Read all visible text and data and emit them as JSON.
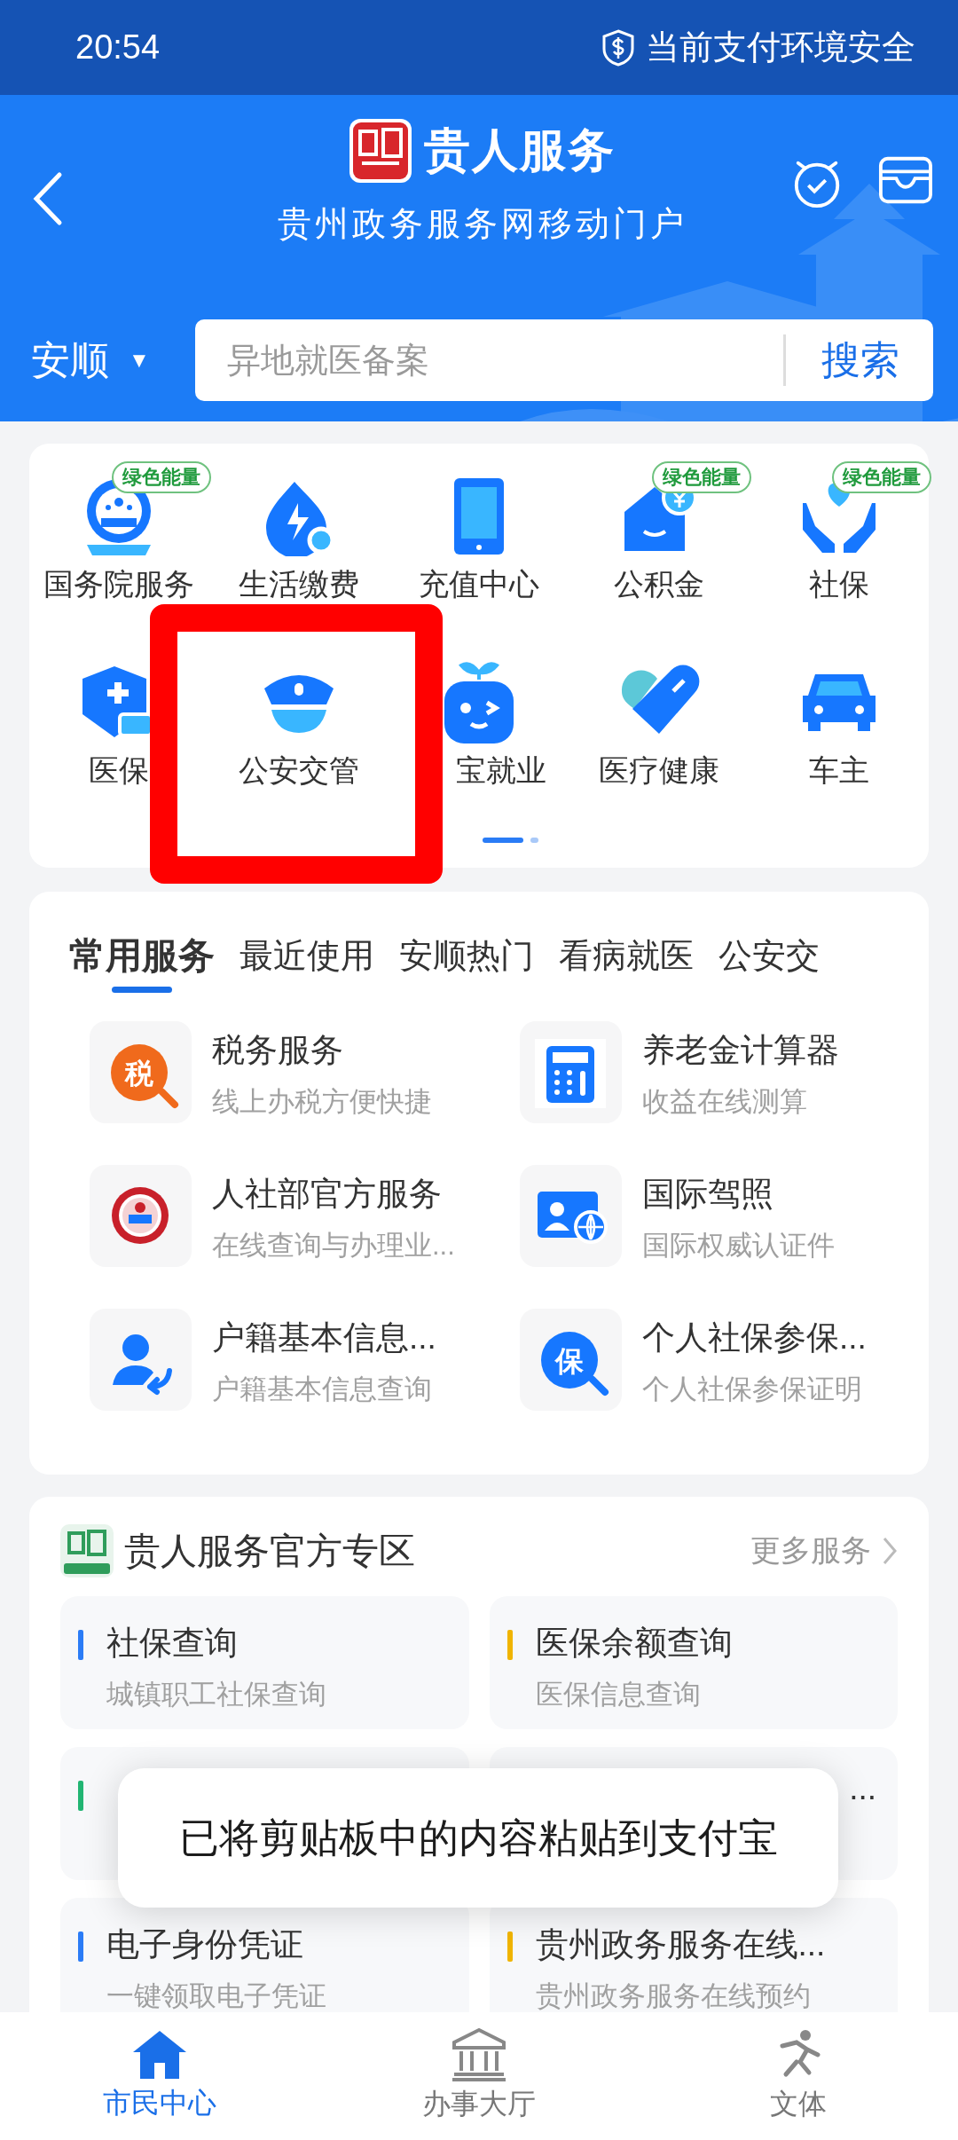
{
  "status_bar": {
    "time": "20:54",
    "security": "当前支付环境安全"
  },
  "header": {
    "app_name": "贵人服务",
    "subtitle": "贵州政务服务网移动门户"
  },
  "location": {
    "city": "安顺",
    "caret": "▼"
  },
  "search": {
    "placeholder": "异地就医备案",
    "button": "搜索"
  },
  "grid": [
    {
      "label": "国务院服务",
      "badge": "绿色能量"
    },
    {
      "label": "生活缴费"
    },
    {
      "label": "充值中心"
    },
    {
      "label": "公积金",
      "badge": "绿色能量"
    },
    {
      "label": "社保",
      "badge": "绿色能量"
    },
    {
      "label": "医保"
    },
    {
      "label": "公安交管"
    },
    {
      "label": "宝就业",
      "covered_left": true
    },
    {
      "label": "医疗健康"
    },
    {
      "label": "车主"
    }
  ],
  "pager": [
    {
      "selected": true
    },
    {
      "selected": false
    }
  ],
  "highlight": {
    "kind": "frame",
    "color": "#ff0000"
  },
  "service_tabs": [
    {
      "label": "常用服务",
      "selected": true
    },
    {
      "label": "最近使用",
      "selected": false
    },
    {
      "label": "安顺热门",
      "selected": false
    },
    {
      "label": "看病就医",
      "selected": false
    },
    {
      "label": "公安交",
      "selected": false
    }
  ],
  "services": [
    {
      "title": "税务服务",
      "subtitle": "线上办税方便快捷",
      "icon_label": "税"
    },
    {
      "title": "养老金计算器",
      "subtitle": "收益在线测算"
    },
    {
      "title": "人社部官方服务",
      "subtitle": "在线查询与办理业..."
    },
    {
      "title": "国际驾照",
      "subtitle": "国际权威认证件"
    },
    {
      "title": "户籍基本信息...",
      "subtitle": "户籍基本信息查询"
    },
    {
      "title": "个人社保参保...",
      "subtitle": "个人社保参保证明",
      "icon_label": "保"
    }
  ],
  "official_zone": {
    "title": "贵人服务官方专区",
    "more": "更多服务",
    "tiles": [
      {
        "title": "社保查询",
        "subtitle": "城镇职工社保查询",
        "color": "#2b7cf6"
      },
      {
        "title": "医保余额查询",
        "subtitle": "医保信息查询",
        "color": "#f0b400"
      },
      {
        "color": "#22b573"
      },
      {
        "kind": "covered",
        "title_end": "..."
      },
      {
        "title": "电子身份凭证",
        "subtitle": "一键领取电子凭证",
        "color": "#2b7cf6"
      },
      {
        "title": "贵州政务服务在线...",
        "subtitle": "贵州政务服务在线预约",
        "color": "#f0b400"
      }
    ]
  },
  "toast": "已将剪贴板中的内容粘贴到支付宝",
  "bottom_nav": [
    {
      "label": "市民中心",
      "selected": true
    },
    {
      "label": "办事大厅",
      "selected": false
    },
    {
      "label": "文体",
      "selected": false
    }
  ]
}
